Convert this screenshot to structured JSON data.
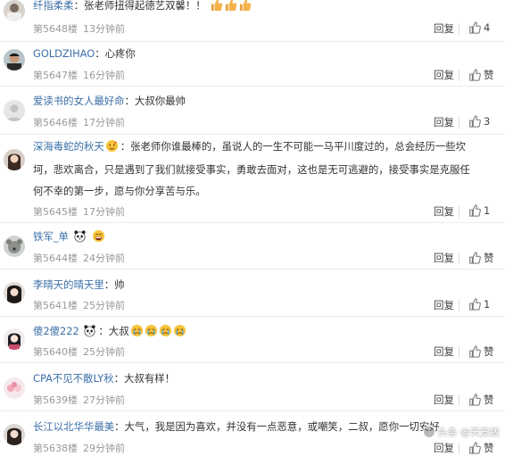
{
  "comments": [
    {
      "username": "纤指柔柔",
      "text": "：张老师扭得起德艺双馨！！",
      "emojis": [
        "thumbs-up",
        "thumbs-up",
        "thumbs-up"
      ],
      "floor": "第5648楼",
      "time": "13分钟前",
      "reply_label": "回复",
      "likes": "4"
    },
    {
      "username": "GOLDZIHAO",
      "text": "：心疼你",
      "emojis": [],
      "floor": "第5647楼",
      "time": "16分钟前",
      "reply_label": "回复",
      "likes": "赞"
    },
    {
      "username": "爱读书的女人最好命",
      "text": "：大叔你最帅",
      "emojis": [],
      "floor": "第5646楼",
      "time": "17分钟前",
      "reply_label": "回复",
      "likes": "3"
    },
    {
      "username": "深海毒蛇的秋天",
      "text": "：张老师你谁最棒的，虽说人的一生不可能一马平川度过的，总会经历一些坎",
      "text_line2": "坷，悲欢离合，只是遇到了我们就接受事实，勇敢去面对，这也是无可逃避的，接受事实是克服任",
      "text_line3": "何不幸的第一步，愿与你分享苦与乐。",
      "emojis": [
        "sparkle-face"
      ],
      "floor": "第5645楼",
      "time": "17分钟前",
      "reply_label": "回复",
      "likes": "1"
    },
    {
      "username": "铁军_单",
      "text": "",
      "emojis": [
        "panda",
        "grin-face"
      ],
      "floor": "第5644楼",
      "time": "24分钟前",
      "reply_label": "回复",
      "likes": "赞"
    },
    {
      "username": "李晴天的晴天里",
      "text": "：帅",
      "emojis": [],
      "floor": "第5641楼",
      "time": "25分钟前",
      "reply_label": "回复",
      "likes": "1"
    },
    {
      "username": "傻2傻222",
      "text": "：大叔",
      "emojis": [
        "panda",
        "cry-face",
        "cry-face",
        "cry-face",
        "cry-face"
      ],
      "floor": "第5640楼",
      "time": "25分钟前",
      "reply_label": "回复",
      "likes": "赞"
    },
    {
      "username": "CPA不见不散LY秋",
      "text": "：大叔有样！",
      "emojis": [],
      "floor": "第5639楼",
      "time": "27分钟前",
      "reply_label": "回复",
      "likes": "赞"
    },
    {
      "username": "长江以北华华最美",
      "text": "：大气，我是因为喜欢，并没有一点恶意，或嘲笑，二叔，愿你一切安好",
      "emojis": [],
      "floor": "第5638楼",
      "time": "29分钟前",
      "reply_label": "回复",
      "likes": "赞"
    }
  ],
  "watermark": "头条 @天安故",
  "colors": {
    "username": "#3c6fa8",
    "meta": "#999999",
    "text": "#333333"
  }
}
